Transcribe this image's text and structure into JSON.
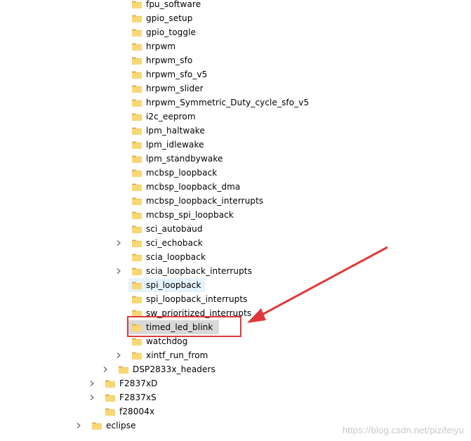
{
  "tree": {
    "items": [
      {
        "label": "fpu_software",
        "indent": 2,
        "chevron": false,
        "state": "none"
      },
      {
        "label": "gpio_setup",
        "indent": 2,
        "chevron": false,
        "state": "none"
      },
      {
        "label": "gpio_toggle",
        "indent": 2,
        "chevron": false,
        "state": "none"
      },
      {
        "label": "hrpwm",
        "indent": 2,
        "chevron": false,
        "state": "none"
      },
      {
        "label": "hrpwm_sfo",
        "indent": 2,
        "chevron": false,
        "state": "none"
      },
      {
        "label": "hrpwm_sfo_v5",
        "indent": 2,
        "chevron": false,
        "state": "none"
      },
      {
        "label": "hrpwm_slider",
        "indent": 2,
        "chevron": false,
        "state": "none"
      },
      {
        "label": "hrpwm_Symmetric_Duty_cycle_sfo_v5",
        "indent": 2,
        "chevron": false,
        "state": "none"
      },
      {
        "label": "i2c_eeprom",
        "indent": 2,
        "chevron": false,
        "state": "none"
      },
      {
        "label": "lpm_haltwake",
        "indent": 2,
        "chevron": false,
        "state": "none"
      },
      {
        "label": "lpm_idlewake",
        "indent": 2,
        "chevron": false,
        "state": "none"
      },
      {
        "label": "lpm_standbywake",
        "indent": 2,
        "chevron": false,
        "state": "none"
      },
      {
        "label": "mcbsp_loopback",
        "indent": 2,
        "chevron": false,
        "state": "none"
      },
      {
        "label": "mcbsp_loopback_dma",
        "indent": 2,
        "chevron": false,
        "state": "none"
      },
      {
        "label": "mcbsp_loopback_interrupts",
        "indent": 2,
        "chevron": false,
        "state": "none"
      },
      {
        "label": "mcbsp_spi_loopback",
        "indent": 2,
        "chevron": false,
        "state": "none"
      },
      {
        "label": "sci_autobaud",
        "indent": 2,
        "chevron": false,
        "state": "none"
      },
      {
        "label": "sci_echoback",
        "indent": 2,
        "chevron": true,
        "state": "none"
      },
      {
        "label": "scia_loopback",
        "indent": 2,
        "chevron": false,
        "state": "none"
      },
      {
        "label": "scia_loopback_interrupts",
        "indent": 2,
        "chevron": true,
        "state": "none"
      },
      {
        "label": "spi_loopback",
        "indent": 2,
        "chevron": false,
        "state": "hover"
      },
      {
        "label": "spi_loopback_interrupts",
        "indent": 2,
        "chevron": false,
        "state": "none"
      },
      {
        "label": "sw_prioritized_interrupts",
        "indent": 2,
        "chevron": false,
        "state": "none"
      },
      {
        "label": "timed_led_blink",
        "indent": 2,
        "chevron": false,
        "state": "selected"
      },
      {
        "label": "watchdog",
        "indent": 2,
        "chevron": false,
        "state": "none"
      },
      {
        "label": "xintf_run_from",
        "indent": 2,
        "chevron": true,
        "state": "none"
      },
      {
        "label": "DSP2833x_headers",
        "indent": 1,
        "chevron": true,
        "state": "none"
      },
      {
        "label": "F2837xD",
        "indent": 0,
        "chevron": true,
        "state": "none"
      },
      {
        "label": "F2837xS",
        "indent": 0,
        "chevron": true,
        "state": "none"
      },
      {
        "label": "f28004x",
        "indent": 0,
        "chevron": false,
        "state": "none"
      },
      {
        "label": "eclipse",
        "indent": -1,
        "chevron": true,
        "state": "none"
      }
    ]
  },
  "watermark": "https://blog.csdn.net/pizifeiyu",
  "colors": {
    "folder": "#f8d775",
    "folder_dark": "#e0b048",
    "annotation": "#e03838",
    "hover": "#e5f3ff",
    "selected": "#d9d9d9"
  }
}
